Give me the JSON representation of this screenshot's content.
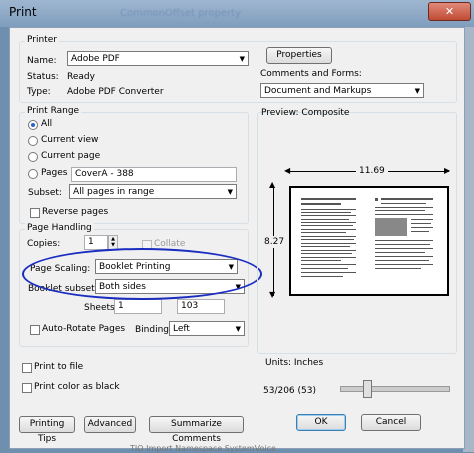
{
  "window": {
    "title": "Print",
    "background_text": "CommonOffset property",
    "close_glyph": "✕"
  },
  "printer": {
    "group_label": "Printer",
    "name_label": "Name:",
    "name_value": "Adobe PDF",
    "status_label": "Status:",
    "status_value": "Ready",
    "type_label": "Type:",
    "type_value": "Adobe PDF Converter",
    "properties_button": "Properties",
    "comments_label": "Comments and Forms:",
    "comments_value": "Document and Markups"
  },
  "print_range": {
    "group_label": "Print Range",
    "all": "All",
    "current_view": "Current view",
    "current_page": "Current page",
    "pages": "Pages",
    "pages_value": "CoverA - 388",
    "subset_label": "Subset:",
    "subset_value": "All pages in range",
    "reverse_pages": "Reverse pages"
  },
  "page_handling": {
    "group_label": "Page Handling",
    "copies_label": "Copies:",
    "copies_value": "1",
    "collate": "Collate",
    "page_scaling_label": "Page Scaling:",
    "page_scaling_value": "Booklet Printing",
    "booklet_subset_label": "Booklet subset:",
    "booklet_subset_value": "Both sides",
    "sheets_from_label": "Sheets from",
    "sheets_from_value": "1",
    "to_label": "to",
    "to_value": "103",
    "auto_rotate": "Auto-Rotate Pages",
    "binding_label": "Binding:",
    "binding_value": "Left"
  },
  "preview": {
    "label": "Preview: Composite",
    "width": "11.69",
    "height": "8.27",
    "units": "Units: Inches",
    "page_counter": "53/206 (53)"
  },
  "options": {
    "print_to_file": "Print to file",
    "print_color_as_black": "Print color as black"
  },
  "buttons": {
    "printing_tips": "Printing Tips",
    "advanced": "Advanced",
    "summarize": "Summarize Comments",
    "ok": "OK",
    "cancel": "Cancel"
  },
  "bottom_caption": "TIO Import Namespace  SystemVoice"
}
